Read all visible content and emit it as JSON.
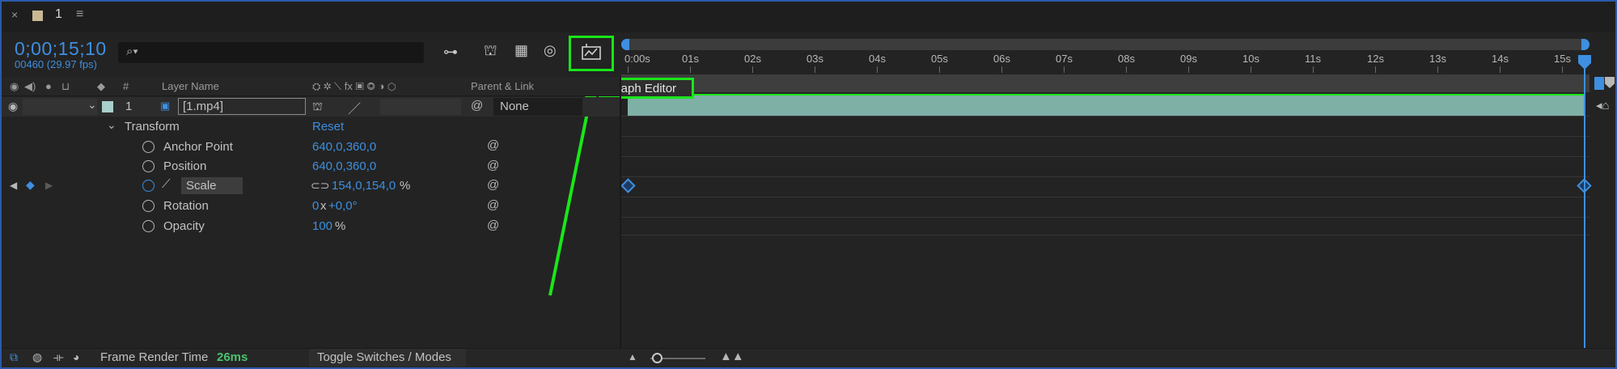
{
  "tab": {
    "close": "×",
    "title": "1",
    "menu": "≡"
  },
  "header": {
    "timecode": "0;00;15;10",
    "fps": "00460 (29.97 fps)",
    "search_placeholder": ""
  },
  "tooltip": {
    "text": "Graph Editor"
  },
  "columns": {
    "hash": "#",
    "layer_name": "Layer Name",
    "parent_link": "Parent & Link"
  },
  "layer": {
    "number": "1",
    "name": "[1.mp4]",
    "parent": "None"
  },
  "transform": {
    "label": "Transform",
    "reset": "Reset",
    "properties": [
      {
        "name": "Anchor Point",
        "value": "640,0,360,0"
      },
      {
        "name": "Position",
        "value": "640,0,360,0"
      },
      {
        "name": "Scale",
        "value_num": "154,0,154,0",
        "value_unit": "%"
      },
      {
        "name": "Rotation",
        "value_prefix": "0",
        "value_mid": "x",
        "value_suffix": "+0,0°"
      },
      {
        "name": "Opacity",
        "value_num": "100",
        "value_unit": "%"
      }
    ]
  },
  "ruler": {
    "labels": [
      "0:00s",
      "01s",
      "02s",
      "03s",
      "04s",
      "05s",
      "06s",
      "07s",
      "08s",
      "09s",
      "10s",
      "11s",
      "12s",
      "13s",
      "14s",
      "15s"
    ]
  },
  "footer": {
    "render_label": "Frame Render Time",
    "render_value": "26ms",
    "toggle": "Toggle Switches / Modes"
  },
  "colors": {
    "accent": "#3e8fe0",
    "highlight": "#19e619",
    "layer_bar": "#7fb0a6",
    "swatch": "#c9b894"
  }
}
